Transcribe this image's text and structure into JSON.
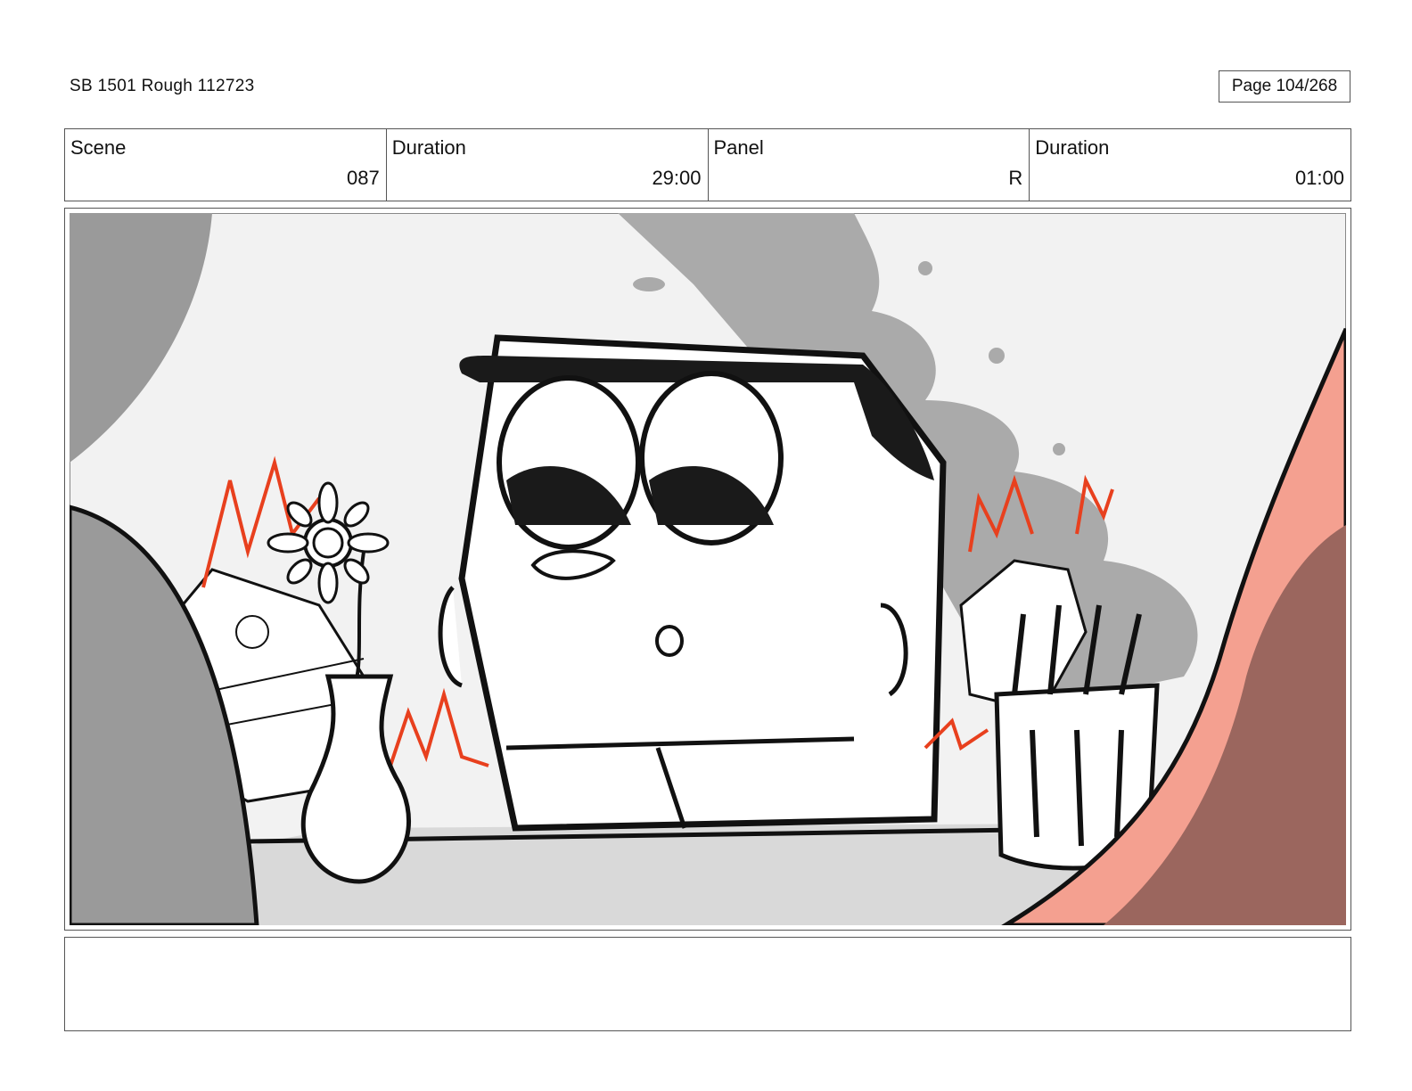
{
  "header": {
    "doc_title": "SB 1501 Rough 112723",
    "page": "Page 104/268"
  },
  "info": {
    "scene_label": "Scene",
    "scene_value": "087",
    "duration1_label": "Duration",
    "duration1_value": "29:00",
    "panel_label": "Panel",
    "panel_value": "R",
    "duration2_label": "Duration",
    "duration2_value": "01:00"
  },
  "notes": {
    "text": ""
  },
  "colors": {
    "fire": "#e8401e",
    "smoke": "#aaaaaa",
    "foreground_left": "#9a9a9a",
    "foreground_right": "#f4a090",
    "ink": "#111111"
  }
}
